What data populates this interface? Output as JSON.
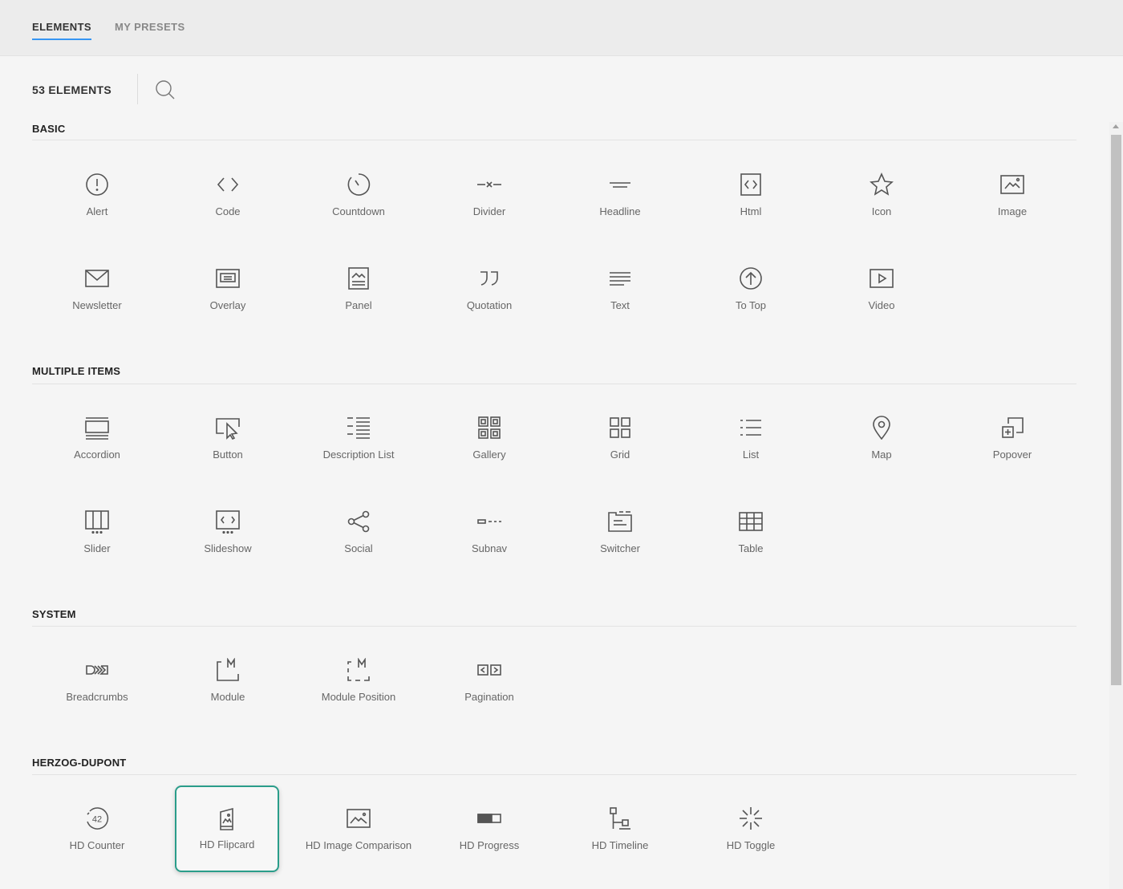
{
  "tabs": [
    {
      "label": "ELEMENTS",
      "active": true
    },
    {
      "label": "MY PRESETS",
      "active": false
    }
  ],
  "count_label": "53 ELEMENTS",
  "accent_color": "#3696f3",
  "highlight_color": "#2a9d8a",
  "sections": [
    {
      "title": "BASIC",
      "items": [
        {
          "label": "Alert",
          "icon": "alert-icon"
        },
        {
          "label": "Code",
          "icon": "code-icon"
        },
        {
          "label": "Countdown",
          "icon": "countdown-icon"
        },
        {
          "label": "Divider",
          "icon": "divider-icon"
        },
        {
          "label": "Headline",
          "icon": "headline-icon"
        },
        {
          "label": "Html",
          "icon": "html-icon"
        },
        {
          "label": "Icon",
          "icon": "star-icon"
        },
        {
          "label": "Image",
          "icon": "image-icon"
        },
        {
          "label": "Newsletter",
          "icon": "envelope-icon"
        },
        {
          "label": "Overlay",
          "icon": "overlay-icon"
        },
        {
          "label": "Panel",
          "icon": "panel-icon"
        },
        {
          "label": "Quotation",
          "icon": "quotation-icon"
        },
        {
          "label": "Text",
          "icon": "text-icon"
        },
        {
          "label": "To Top",
          "icon": "to-top-icon"
        },
        {
          "label": "Video",
          "icon": "video-icon"
        }
      ]
    },
    {
      "title": "MULTIPLE ITEMS",
      "items": [
        {
          "label": "Accordion",
          "icon": "accordion-icon"
        },
        {
          "label": "Button",
          "icon": "button-icon"
        },
        {
          "label": "Description List",
          "icon": "description-list-icon"
        },
        {
          "label": "Gallery",
          "icon": "gallery-icon"
        },
        {
          "label": "Grid",
          "icon": "grid-icon"
        },
        {
          "label": "List",
          "icon": "list-icon"
        },
        {
          "label": "Map",
          "icon": "map-pin-icon"
        },
        {
          "label": "Popover",
          "icon": "popover-icon"
        },
        {
          "label": "Slider",
          "icon": "slider-icon"
        },
        {
          "label": "Slideshow",
          "icon": "slideshow-icon"
        },
        {
          "label": "Social",
          "icon": "share-icon"
        },
        {
          "label": "Subnav",
          "icon": "subnav-icon"
        },
        {
          "label": "Switcher",
          "icon": "switcher-icon"
        },
        {
          "label": "Table",
          "icon": "table-icon"
        }
      ]
    },
    {
      "title": "SYSTEM",
      "items": [
        {
          "label": "Breadcrumbs",
          "icon": "breadcrumbs-icon"
        },
        {
          "label": "Module",
          "icon": "module-icon"
        },
        {
          "label": "Module Position",
          "icon": "module-position-icon"
        },
        {
          "label": "Pagination",
          "icon": "pagination-icon"
        }
      ]
    },
    {
      "title": "HERZOG-DUPONT",
      "items": [
        {
          "label": "HD Counter",
          "icon": "counter-icon",
          "icon_text": "42"
        },
        {
          "label": "HD Flipcard",
          "icon": "flipcard-icon",
          "highlighted": true
        },
        {
          "label": "HD Image Comparison",
          "icon": "image-comparison-icon"
        },
        {
          "label": "HD Progress",
          "icon": "progress-icon"
        },
        {
          "label": "HD Timeline",
          "icon": "timeline-icon"
        },
        {
          "label": "HD Toggle",
          "icon": "toggle-icon"
        }
      ]
    }
  ]
}
